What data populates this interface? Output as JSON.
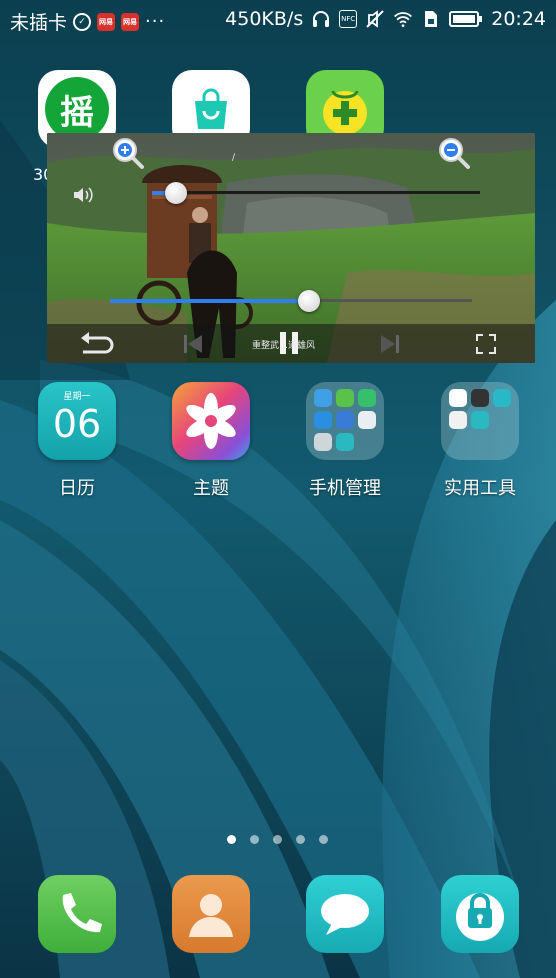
{
  "status_bar": {
    "carrier": "未插卡",
    "network_speed": "450KB/s",
    "time": "20:24",
    "notification_badge_1": "网易",
    "notification_badge_2": "网易",
    "more": "···",
    "nfc": "NFC"
  },
  "apps_top": {
    "shake_icon_text": "摇",
    "edge_text": "30"
  },
  "video_player": {
    "volume_level": 0.04,
    "progress": 0.55,
    "caption_text": "重整武…道雄风",
    "title_fragment": "/"
  },
  "apps_row2": [
    {
      "label": "日历",
      "icon": "calendar-icon",
      "weekday": "星期一",
      "day": "06"
    },
    {
      "label": "主题",
      "icon": "theme-flower-icon"
    },
    {
      "label": "手机管理",
      "icon": "folder-icon"
    },
    {
      "label": "实用工具",
      "icon": "folder-icon"
    }
  ],
  "page_indicator": {
    "count": 5,
    "active": 0
  },
  "dock": [
    {
      "name": "phone",
      "icon": "phone-icon"
    },
    {
      "name": "contacts",
      "icon": "contacts-icon"
    },
    {
      "name": "messages",
      "icon": "message-icon"
    },
    {
      "name": "lock",
      "icon": "lock-icon"
    }
  ],
  "colors": {
    "accent_blue": "#2f7ff0",
    "shake_green": "#13a538",
    "dock_green": "#4fc14a",
    "dock_orange": "#e08a3c",
    "dock_teal": "#24bfc4"
  }
}
